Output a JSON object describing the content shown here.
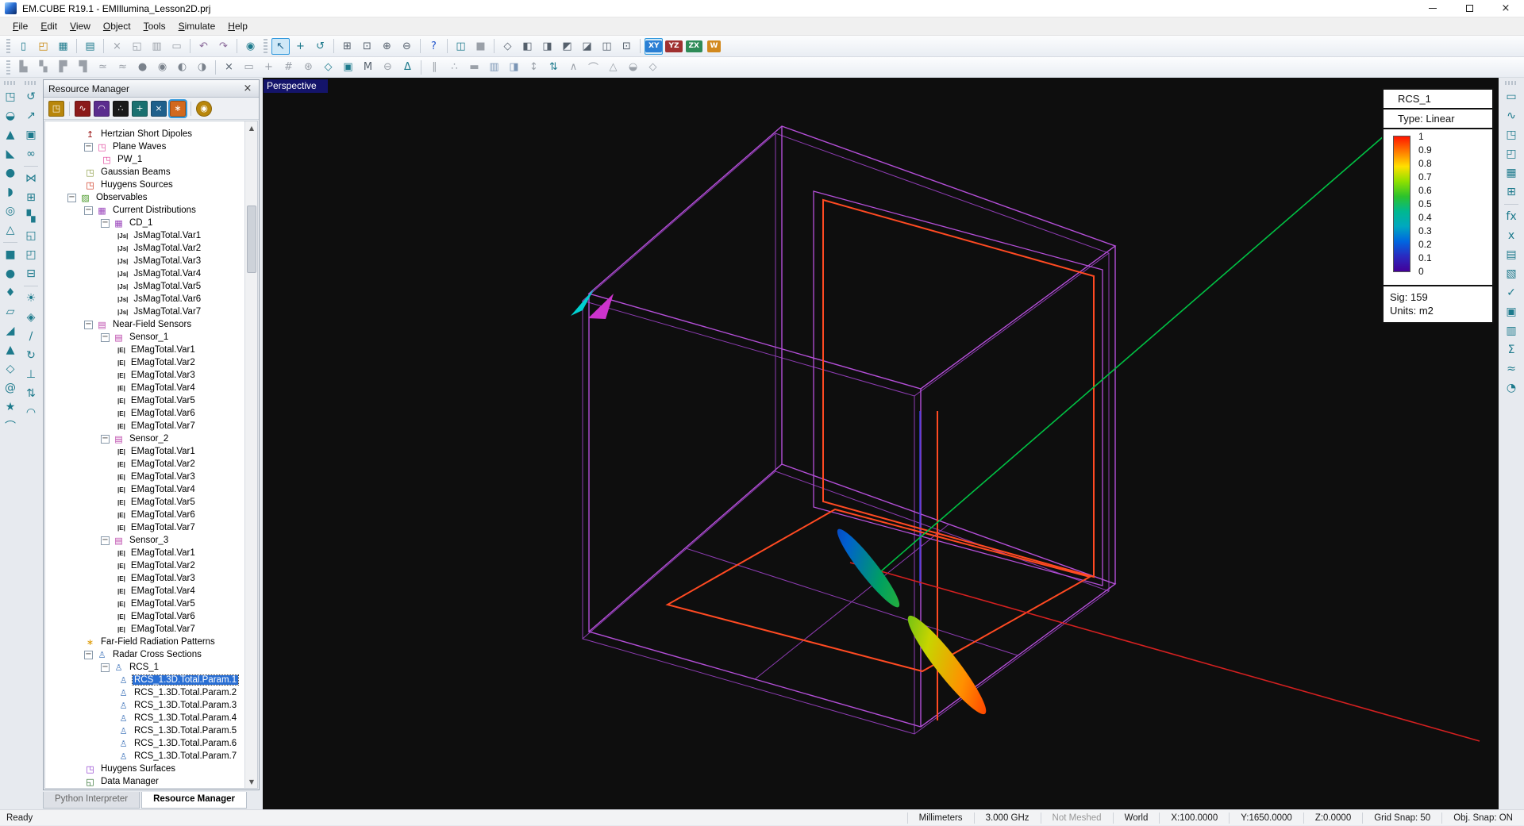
{
  "window": {
    "title": "EM.CUBE R19.1 - EMIllumina_Lesson2D.prj",
    "controls": {
      "minimize": "minimize",
      "maximize": "maximize",
      "close": "close"
    }
  },
  "menu": {
    "items": [
      "File",
      "Edit",
      "View",
      "Object",
      "Tools",
      "Simulate",
      "Help"
    ]
  },
  "toolbar1": [
    {
      "sep": "grip"
    },
    {
      "n": "new-project",
      "g": "▯",
      "c": "#1d7a8c"
    },
    {
      "n": "open-project",
      "g": "◰",
      "c": "#c8860a"
    },
    {
      "n": "save",
      "g": "▦",
      "c": "#1d7a8c"
    },
    {
      "sep": true
    },
    {
      "n": "print",
      "g": "▤",
      "c": "#1d7a8c"
    },
    {
      "sep": true
    },
    {
      "n": "cut",
      "g": "×",
      "c": "#9aa0a8"
    },
    {
      "n": "copy",
      "g": "◱",
      "c": "#9aa0a8"
    },
    {
      "n": "paste",
      "g": "▥",
      "c": "#9aa0a8"
    },
    {
      "n": "delete",
      "g": "▭",
      "c": "#9aa0a8"
    },
    {
      "sep": true
    },
    {
      "n": "undo",
      "g": "↶",
      "c": "#8a6a9a"
    },
    {
      "n": "redo",
      "g": "↷",
      "c": "#8a6a9a"
    },
    {
      "sep": true
    },
    {
      "n": "project-explorer",
      "g": "◉",
      "c": "#1d7a8c"
    },
    {
      "sep": "grip"
    },
    {
      "n": "select-tool",
      "g": "↖",
      "c": "#1a5f8a",
      "sel": true
    },
    {
      "n": "pan-tool",
      "g": "+",
      "c": "#1d7a8c"
    },
    {
      "n": "orbit-tool",
      "g": "↺",
      "c": "#1d7a8c"
    },
    {
      "sep": true
    },
    {
      "n": "zoom-window",
      "g": "⊞",
      "c": "#55606c"
    },
    {
      "n": "zoom-extents",
      "g": "⊡",
      "c": "#55606c"
    },
    {
      "n": "zoom-in",
      "g": "⊕",
      "c": "#55606c"
    },
    {
      "n": "zoom-out",
      "g": "⊖",
      "c": "#55606c"
    },
    {
      "sep": true
    },
    {
      "n": "whats-this",
      "g": "?",
      "c": "#2255cc"
    },
    {
      "sep": true
    },
    {
      "n": "toggle-panels",
      "g": "◫",
      "c": "#1d7a8c"
    },
    {
      "n": "render-mode",
      "g": "■",
      "c": "#9aa0a8"
    },
    {
      "sep": true
    },
    {
      "n": "view-isometric",
      "g": "◇",
      "c": "#55606c"
    },
    {
      "n": "view-front",
      "g": "◧",
      "c": "#55606c"
    },
    {
      "n": "view-back",
      "g": "◨",
      "c": "#55606c"
    },
    {
      "n": "view-left",
      "g": "◩",
      "c": "#55606c"
    },
    {
      "n": "view-right",
      "g": "◪",
      "c": "#55606c"
    },
    {
      "n": "view-top",
      "g": "◫",
      "c": "#55606c"
    },
    {
      "n": "view-bottom",
      "g": "⊡",
      "c": "#55606c"
    },
    {
      "sep": true
    },
    {
      "n": "plane-xy",
      "t": "XY",
      "badge": "#2b7fd4",
      "sel": true
    },
    {
      "n": "plane-yz",
      "t": "YZ",
      "badge": "#a03030"
    },
    {
      "n": "plane-zx",
      "t": "ZX",
      "badge": "#2e8b57"
    },
    {
      "n": "plane-w",
      "t": "W",
      "badge": "#d2891e"
    }
  ],
  "toolbar2": [
    {
      "sep": "grip"
    },
    {
      "n": "extrude-up",
      "g": "▙",
      "c": "#9aa0a8"
    },
    {
      "n": "extrude-checker",
      "g": "▚",
      "c": "#9aa0a8"
    },
    {
      "n": "loft",
      "g": "▛",
      "c": "#9aa0a8"
    },
    {
      "n": "sweep",
      "g": "▜",
      "c": "#9aa0a8"
    },
    {
      "n": "flatten",
      "g": "≃",
      "c": "#9aa0a8"
    },
    {
      "n": "smooth",
      "g": "≈",
      "c": "#9aa0a8"
    },
    {
      "n": "node-dark",
      "g": "●",
      "c": "#7a828c"
    },
    {
      "n": "node-ring",
      "g": "◉",
      "c": "#7a828c"
    },
    {
      "n": "half-left",
      "g": "◐",
      "c": "#7a828c"
    },
    {
      "n": "half-right",
      "g": "◑",
      "c": "#7a828c"
    },
    {
      "sep": true
    },
    {
      "n": "delete-object",
      "g": "×",
      "c": "#55606c"
    },
    {
      "n": "bounding-box",
      "g": "▭",
      "c": "#9aa0a8"
    },
    {
      "n": "move-origin",
      "g": "+",
      "c": "#9aa0a8"
    },
    {
      "n": "grid-hash",
      "g": "#",
      "c": "#9aa0a8"
    },
    {
      "n": "snap-target",
      "g": "⊛",
      "c": "#9aa0a8"
    },
    {
      "n": "vertex-diamond",
      "g": "◇",
      "c": "#1d7a8c"
    },
    {
      "n": "solid-view",
      "g": "▣",
      "c": "#1d7a8c"
    },
    {
      "n": "material",
      "g": "M",
      "c": "#55606c"
    },
    {
      "n": "boolean-subtract",
      "g": "⊖",
      "c": "#9aa0a8"
    },
    {
      "n": "mesh-delta",
      "g": "Δ",
      "c": "#1d7a8c"
    },
    {
      "sep": true
    },
    {
      "n": "parallel-lines",
      "g": "∥",
      "c": "#9aa0a8"
    },
    {
      "n": "point-set",
      "g": "∴",
      "c": "#9aa0a8"
    },
    {
      "n": "thick-bar",
      "g": "▬",
      "c": "#9aa0a8"
    },
    {
      "n": "mesh-view",
      "g": "▥",
      "c": "#7a95b5"
    },
    {
      "n": "half-shade",
      "g": "◨",
      "c": "#7a95b5"
    },
    {
      "n": "fit-vertical",
      "g": "↕",
      "c": "#9aa0a8"
    },
    {
      "n": "swap-vertical",
      "g": "⇅",
      "c": "#1d7a8c"
    },
    {
      "n": "angle",
      "g": "∧",
      "c": "#9aa0a8"
    },
    {
      "n": "arc-tool",
      "g": "⌒",
      "c": "#9aa0a8"
    },
    {
      "n": "polygon-tool",
      "g": "△",
      "c": "#9aa0a8"
    },
    {
      "n": "dome-tool",
      "g": "◒",
      "c": "#9aa0a8"
    },
    {
      "n": "polyhedron-tool",
      "g": "◇",
      "c": "#9aa0a8"
    }
  ],
  "left_toolbar_col1": [
    {
      "n": "draw-cube",
      "g": "◳"
    },
    {
      "n": "draw-cylinder",
      "g": "◒"
    },
    {
      "n": "draw-cone",
      "g": "▲"
    },
    {
      "n": "draw-pyramid",
      "g": "◣"
    },
    {
      "n": "draw-sphere",
      "g": "●"
    },
    {
      "n": "draw-ellipsoid",
      "g": "◗"
    },
    {
      "n": "draw-torus",
      "g": "◎"
    },
    {
      "n": "draw-tetrahedron",
      "g": "△"
    },
    {
      "sep": true
    },
    {
      "n": "draw-rectangle",
      "g": "■"
    },
    {
      "n": "draw-circle",
      "g": "●"
    },
    {
      "n": "draw-teardrop",
      "g": "♦"
    },
    {
      "n": "draw-ellipse",
      "g": "▱"
    },
    {
      "n": "draw-right-triangle",
      "g": "◢"
    },
    {
      "n": "draw-triangle",
      "g": "▲"
    },
    {
      "n": "draw-hexagon",
      "g": "◇"
    },
    {
      "n": "draw-spiral",
      "g": "@"
    },
    {
      "n": "draw-star",
      "g": "★"
    },
    {
      "n": "draw-curve",
      "g": "⌒"
    }
  ],
  "left_toolbar_col2": [
    {
      "n": "rotate-object",
      "g": "↺"
    },
    {
      "n": "move-object",
      "g": "↗"
    },
    {
      "n": "scale-object",
      "g": "▣"
    },
    {
      "n": "link-objects",
      "g": "∞"
    },
    {
      "sep": true
    },
    {
      "n": "mirror-object",
      "g": "⋈"
    },
    {
      "n": "array-grid",
      "g": "⊞"
    },
    {
      "n": "checker-pattern",
      "g": "▚"
    },
    {
      "n": "copy-shape",
      "g": "◱"
    },
    {
      "n": "overlap-shapes",
      "g": "◰"
    },
    {
      "n": "subtract-shapes",
      "g": "⊟"
    },
    {
      "sep": true
    },
    {
      "n": "illumination",
      "g": "☀"
    },
    {
      "n": "gem-surface",
      "g": "◈"
    },
    {
      "n": "pen-edit",
      "g": "∕"
    },
    {
      "n": "revolve",
      "g": "↻"
    },
    {
      "n": "perpendicular",
      "g": "⊥"
    },
    {
      "n": "swap-order",
      "g": "⇅"
    },
    {
      "n": "arch-surface",
      "g": "◠"
    }
  ],
  "right_toolbar": [
    {
      "n": "ruler-measure",
      "g": "▭"
    },
    {
      "n": "waveform-view",
      "g": "∿"
    },
    {
      "n": "box-3d",
      "g": "◳"
    },
    {
      "n": "cube-wire",
      "g": "◰"
    },
    {
      "n": "mesh-grid",
      "g": "▦"
    },
    {
      "n": "port-grid",
      "g": "⊞"
    },
    {
      "sep": true
    },
    {
      "n": "function-fx",
      "t": "fx"
    },
    {
      "n": "variable-x",
      "t": "x"
    },
    {
      "n": "document-view",
      "g": "▤"
    },
    {
      "n": "edit-document",
      "g": "▧"
    },
    {
      "n": "checklist",
      "g": "✓"
    },
    {
      "n": "image-view",
      "g": "▣"
    },
    {
      "n": "table-view",
      "g": "▥"
    },
    {
      "n": "sum-results",
      "t": "Σ"
    },
    {
      "n": "approximate",
      "g": "≈"
    },
    {
      "n": "pie-chart",
      "g": "◔"
    }
  ],
  "resource_manager": {
    "title": "Resource Manager",
    "close_glyph": "×",
    "modules": [
      {
        "n": "module-cubecad",
        "c": "#b8860b",
        "g": "◳"
      },
      {
        "sep": true
      },
      {
        "n": "module-tempo",
        "c": "#8b1a1a",
        "g": "∿"
      },
      {
        "n": "module-picasso",
        "c": "#5b2d8e",
        "g": "◠"
      },
      {
        "n": "module-libera",
        "c": "#1a1a1a",
        "g": "∴"
      },
      {
        "n": "module-terrano",
        "c": "#1a7070",
        "g": "+"
      },
      {
        "n": "module-ferma",
        "c": "#1f5f8b",
        "g": "×"
      },
      {
        "n": "module-illumina",
        "c": "#d2691e",
        "g": "∗",
        "sel": true
      },
      {
        "sep": true
      },
      {
        "n": "module-selector",
        "c": "#b8860b",
        "g": "◉",
        "round": true
      }
    ],
    "tree": [
      {
        "label": "Hertzian Short Dipoles",
        "lvl": 1,
        "icon": {
          "g": "↥",
          "c": "#991111"
        }
      },
      {
        "label": "Plane Waves",
        "lvl": 1,
        "exp": "-",
        "icon": {
          "g": "◳",
          "c": "#e0409a"
        }
      },
      {
        "label": "PW_1",
        "lvl": 2,
        "icon": {
          "g": "◳",
          "c": "#e0409a"
        }
      },
      {
        "label": "Gaussian Beams",
        "lvl": 1,
        "icon": {
          "g": "◳",
          "c": "#8a9a40"
        }
      },
      {
        "label": "Huygens Sources",
        "lvl": 1,
        "icon": {
          "g": "◳",
          "c": "#cc2a10"
        }
      },
      {
        "label": "Observables",
        "lvl": 0,
        "exp": "-",
        "icon": {
          "g": "▨",
          "c": "#4a9a2a"
        }
      },
      {
        "label": "Current Distributions",
        "lvl": 1,
        "exp": "-",
        "icon": {
          "g": "▦",
          "c": "#9a44bb"
        }
      },
      {
        "label": "CD_1",
        "lvl": 2,
        "exp": "-",
        "icon": {
          "g": "▦",
          "c": "#9a44bb"
        }
      },
      {
        "label": "JsMagTotal.Var1",
        "lvl": 3,
        "pill": "|Js|"
      },
      {
        "label": "JsMagTotal.Var2",
        "lvl": 3,
        "pill": "|Js|"
      },
      {
        "label": "JsMagTotal.Var3",
        "lvl": 3,
        "pill": "|Js|"
      },
      {
        "label": "JsMagTotal.Var4",
        "lvl": 3,
        "pill": "|Js|"
      },
      {
        "label": "JsMagTotal.Var5",
        "lvl": 3,
        "pill": "|Js|"
      },
      {
        "label": "JsMagTotal.Var6",
        "lvl": 3,
        "pill": "|Js|"
      },
      {
        "label": "JsMagTotal.Var7",
        "lvl": 3,
        "pill": "|Js|"
      },
      {
        "label": "Near-Field Sensors",
        "lvl": 1,
        "exp": "-",
        "icon": {
          "g": "▤",
          "c": "#bb44aa"
        }
      },
      {
        "label": "Sensor_1",
        "lvl": 2,
        "exp": "-",
        "icon": {
          "g": "▤",
          "c": "#bb44aa"
        }
      },
      {
        "label": "EMagTotal.Var1",
        "lvl": 3,
        "pill": "|E|"
      },
      {
        "label": "EMagTotal.Var2",
        "lvl": 3,
        "pill": "|E|"
      },
      {
        "label": "EMagTotal.Var3",
        "lvl": 3,
        "pill": "|E|"
      },
      {
        "label": "EMagTotal.Var4",
        "lvl": 3,
        "pill": "|E|"
      },
      {
        "label": "EMagTotal.Var5",
        "lvl": 3,
        "pill": "|E|"
      },
      {
        "label": "EMagTotal.Var6",
        "lvl": 3,
        "pill": "|E|"
      },
      {
        "label": "EMagTotal.Var7",
        "lvl": 3,
        "pill": "|E|"
      },
      {
        "label": "Sensor_2",
        "lvl": 2,
        "exp": "-",
        "icon": {
          "g": "▤",
          "c": "#bb44aa"
        }
      },
      {
        "label": "EMagTotal.Var1",
        "lvl": 3,
        "pill": "|E|"
      },
      {
        "label": "EMagTotal.Var2",
        "lvl": 3,
        "pill": "|E|"
      },
      {
        "label": "EMagTotal.Var3",
        "lvl": 3,
        "pill": "|E|"
      },
      {
        "label": "EMagTotal.Var4",
        "lvl": 3,
        "pill": "|E|"
      },
      {
        "label": "EMagTotal.Var5",
        "lvl": 3,
        "pill": "|E|"
      },
      {
        "label": "EMagTotal.Var6",
        "lvl": 3,
        "pill": "|E|"
      },
      {
        "label": "EMagTotal.Var7",
        "lvl": 3,
        "pill": "|E|"
      },
      {
        "label": "Sensor_3",
        "lvl": 2,
        "exp": "-",
        "icon": {
          "g": "▤",
          "c": "#bb44aa"
        }
      },
      {
        "label": "EMagTotal.Var1",
        "lvl": 3,
        "pill": "|E|"
      },
      {
        "label": "EMagTotal.Var2",
        "lvl": 3,
        "pill": "|E|"
      },
      {
        "label": "EMagTotal.Var3",
        "lvl": 3,
        "pill": "|E|"
      },
      {
        "label": "EMagTotal.Var4",
        "lvl": 3,
        "pill": "|E|"
      },
      {
        "label": "EMagTotal.Var5",
        "lvl": 3,
        "pill": "|E|"
      },
      {
        "label": "EMagTotal.Var6",
        "lvl": 3,
        "pill": "|E|"
      },
      {
        "label": "EMagTotal.Var7",
        "lvl": 3,
        "pill": "|E|"
      },
      {
        "label": "Far-Field Radiation Patterns",
        "lvl": 1,
        "icon": {
          "g": "∗",
          "c": "#dd9900"
        }
      },
      {
        "label": "Radar Cross Sections",
        "lvl": 1,
        "exp": "-",
        "icon": {
          "g": "♙",
          "c": "#4477bb"
        }
      },
      {
        "label": "RCS_1",
        "lvl": 2,
        "exp": "-",
        "icon": {
          "g": "♙",
          "c": "#4477bb"
        }
      },
      {
        "label": "RCS_1.3D.Total.Param.1",
        "lvl": 3,
        "icon": {
          "g": "♙",
          "c": "#4477bb"
        },
        "sel": true
      },
      {
        "label": "RCS_1.3D.Total.Param.2",
        "lvl": 3,
        "icon": {
          "g": "♙",
          "c": "#4477bb"
        }
      },
      {
        "label": "RCS_1.3D.Total.Param.3",
        "lvl": 3,
        "icon": {
          "g": "♙",
          "c": "#4477bb"
        }
      },
      {
        "label": "RCS_1.3D.Total.Param.4",
        "lvl": 3,
        "icon": {
          "g": "♙",
          "c": "#4477bb"
        }
      },
      {
        "label": "RCS_1.3D.Total.Param.5",
        "lvl": 3,
        "icon": {
          "g": "♙",
          "c": "#4477bb"
        }
      },
      {
        "label": "RCS_1.3D.Total.Param.6",
        "lvl": 3,
        "icon": {
          "g": "♙",
          "c": "#4477bb"
        }
      },
      {
        "label": "RCS_1.3D.Total.Param.7",
        "lvl": 3,
        "icon": {
          "g": "♙",
          "c": "#4477bb"
        }
      },
      {
        "label": "Huygens Surfaces",
        "lvl": 1,
        "icon": {
          "g": "◳",
          "c": "#8833cc"
        }
      },
      {
        "label": "Data Manager",
        "lvl": 1,
        "icon": {
          "g": "◱",
          "c": "#226622"
        }
      }
    ],
    "tabs": [
      {
        "label": "Python Interpreter",
        "active": false
      },
      {
        "label": "Resource Manager",
        "active": true
      }
    ]
  },
  "viewport": {
    "label": "Perspective",
    "legend": {
      "title": "RCS_1",
      "type_label": "Type: Linear",
      "ticks": [
        "1",
        "0.9",
        "0.8",
        "0.7",
        "0.6",
        "0.5",
        "0.4",
        "0.3",
        "0.2",
        "0.1",
        "0"
      ],
      "sig": "Sig: 159",
      "units": "Units: m2",
      "colorbar_stops": [
        "#ff1500",
        "#ff7a00",
        "#ffe000",
        "#8fe000",
        "#2cc22c",
        "#00b890",
        "#00a8c0",
        "#0066e0",
        "#2a2ac0",
        "#440099"
      ]
    },
    "colors": {
      "wireframe": "#b44fd8",
      "wireframe_dim": "#8d3cb2",
      "plate": "#ff4a22",
      "axis_x": "#d42020",
      "axis_y": "#00c244",
      "axis_z": "#3a3ae0",
      "arrow_cyan": "#00d0d0",
      "arrow_magenta": "#cc33cc"
    },
    "lobe_gradient": [
      "#1818a0",
      "#0060d0",
      "#00a060",
      "#40b820",
      "#c8d400",
      "#ff9000",
      "#ff2800"
    ]
  },
  "statusbar": {
    "ready": "Ready",
    "fields": [
      {
        "n": "units",
        "t": "Millimeters"
      },
      {
        "n": "frequency",
        "t": "3.000 GHz"
      },
      {
        "n": "mesh-status",
        "t": "Not Meshed",
        "dim": true
      },
      {
        "n": "coord-system",
        "t": "World"
      },
      {
        "n": "coord-x",
        "t": "X:100.0000"
      },
      {
        "n": "coord-y",
        "t": "Y:1650.0000"
      },
      {
        "n": "coord-z",
        "t": "Z:0.0000"
      },
      {
        "n": "grid-snap",
        "t": "Grid Snap: 50",
        "click": true
      },
      {
        "n": "obj-snap",
        "t": "Obj. Snap: ON",
        "click": true
      }
    ]
  }
}
